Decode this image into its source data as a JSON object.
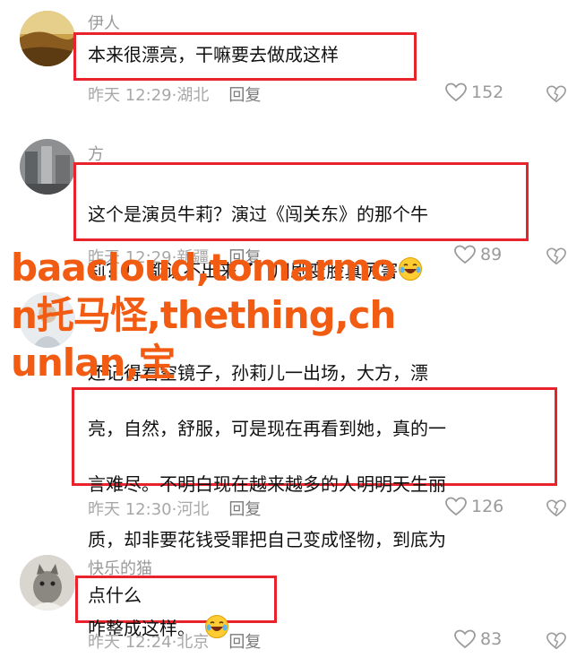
{
  "comments": [
    {
      "username": "伊人",
      "text": "本来很漂亮，干嘛要去做成这样",
      "time": "昨天 12:29·湖北",
      "reply_label": "回复",
      "likes": "152"
    },
    {
      "username": "方",
      "text_line1": "这个是演员牛莉？演过《闯关东》的那个牛",
      "text_line2": "莉？！ 都认不出来了！川剧变脸真厉害",
      "time": "昨天 12:29·新疆",
      "reply_label": "回复",
      "likes": "89"
    },
    {
      "username": "",
      "text_line1": "还记得看空镜子，孙莉儿一出场，大方，漂",
      "text_line2": "亮，自然，舒服，可是现在再看到她，真的一",
      "text_line3": "言难尽。不明白现在越来越多的人明明天生丽",
      "text_line4": "质，却非要花钱受罪把自己变成怪物，到底为",
      "text_line5": "点什么",
      "time": "昨天 12:30·河北",
      "reply_label": "回复",
      "likes": "126"
    },
    {
      "username": "快乐的猫",
      "text": "咋整成这样。",
      "time": "昨天 12:24·北京",
      "reply_label": "回复",
      "likes": "83"
    }
  ],
  "watermark": "baacloud,tomarmon托马怪,thething,chunlan,宝"
}
